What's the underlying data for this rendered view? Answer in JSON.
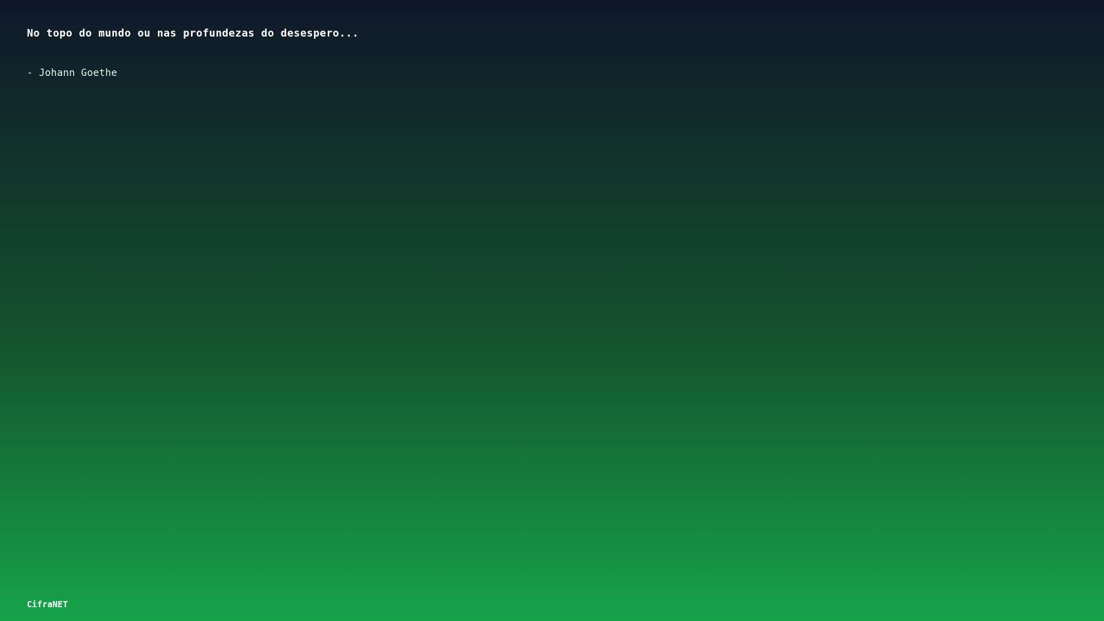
{
  "quote": {
    "text": "No topo do mundo ou nas profundezas do desespero...",
    "author": "- Johann Goethe"
  },
  "footer": {
    "brand": "CifraNET"
  },
  "colors": {
    "gradient_top": "#0f172a",
    "gradient_mid": "#14532d",
    "gradient_bottom": "#16a34a",
    "text": "#ffffff"
  }
}
